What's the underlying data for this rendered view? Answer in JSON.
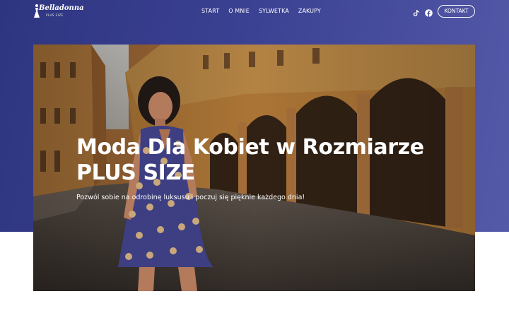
{
  "brand": {
    "logo_text": "Belladonna",
    "logo_sub": "PLUS SIZE"
  },
  "nav": {
    "items": [
      {
        "label": "START"
      },
      {
        "label": "O MNIE"
      },
      {
        "label": "SYLWETKA"
      },
      {
        "label": "ZAKUPY"
      }
    ],
    "social": [
      {
        "icon": "tiktok-icon"
      },
      {
        "icon": "facebook-icon"
      }
    ],
    "contact_label": "KONTAKT"
  },
  "hero": {
    "title_line1": "Moda Dla Kobiet w Rozmiarze",
    "title_line2": "PLUS SIZE",
    "subtitle": "Pozwól sobie na odrobinę luksusu i poczuj się pięknie każdego dnia!"
  },
  "colors": {
    "band_start": "#2e3580",
    "band_end": "#5459a8",
    "text": "#ffffff",
    "dress": "#3d3f82",
    "dots": "#c9a77a"
  }
}
